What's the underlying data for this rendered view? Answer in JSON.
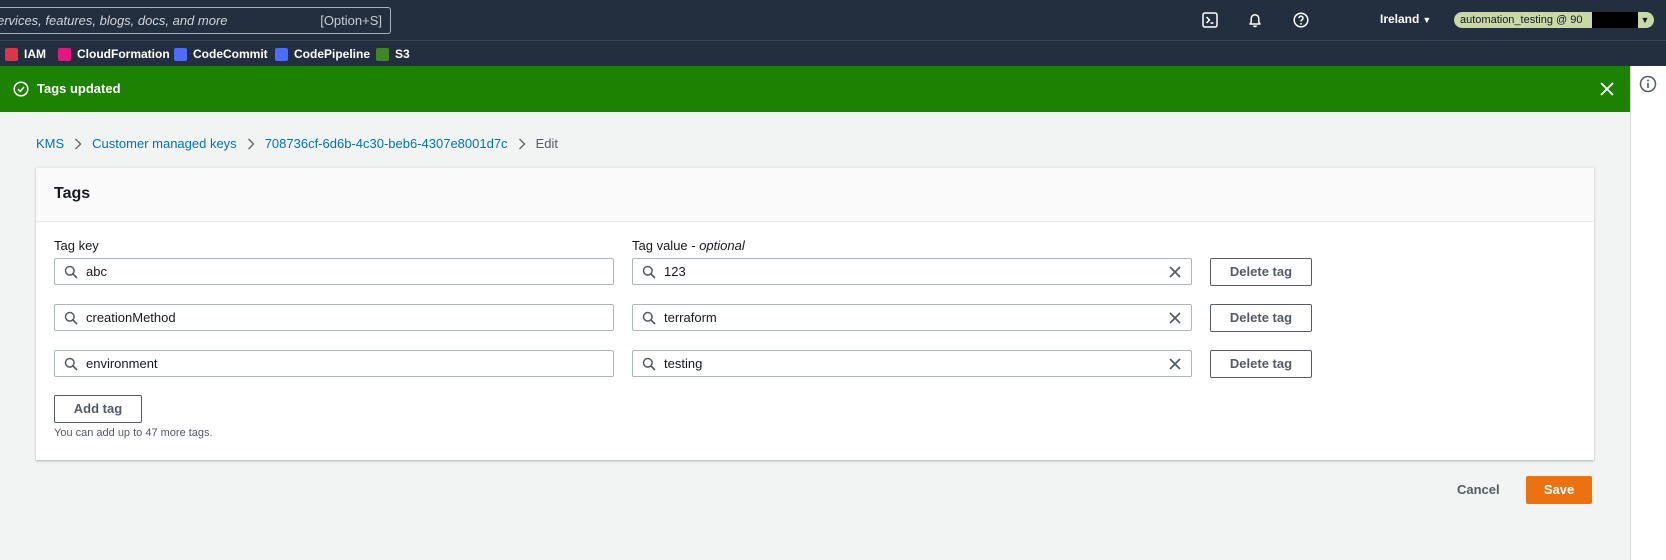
{
  "topnav": {
    "search_placeholder": "ervices, features, blogs, docs, and more",
    "search_shortcut": "[Option+S]",
    "region": "Ireland",
    "account": "automation_testing @ 90"
  },
  "favorites": [
    {
      "label": "IAM",
      "color": "#dd344c"
    },
    {
      "label": "CloudFormation",
      "color": "#e7157b"
    },
    {
      "label": "CodeCommit",
      "color": "#4d6bfe"
    },
    {
      "label": "CodePipeline",
      "color": "#4d6bfe"
    },
    {
      "label": "S3",
      "color": "#3f8624"
    }
  ],
  "flash": {
    "message": "Tags updated",
    "color": "#1d8102"
  },
  "breadcrumb": {
    "items": [
      "KMS",
      "Customer managed keys",
      "708736cf-6d6b-4c30-beb6-4307e8001d7c"
    ],
    "current": "Edit"
  },
  "panel": {
    "title": "Tags",
    "key_label": "Tag key",
    "value_label": "Tag value - ",
    "value_label_optional": "optional",
    "delete_label": "Delete tag",
    "add_label": "Add tag",
    "hint": "You can add up to 47 more tags.",
    "rows": [
      {
        "key": "abc",
        "value": "123"
      },
      {
        "key": "creationMethod",
        "value": "terraform"
      },
      {
        "key": "environment",
        "value": "testing"
      }
    ]
  },
  "footer": {
    "cancel_label": "Cancel",
    "save_label": "Save",
    "save_color": "#ec7211"
  }
}
